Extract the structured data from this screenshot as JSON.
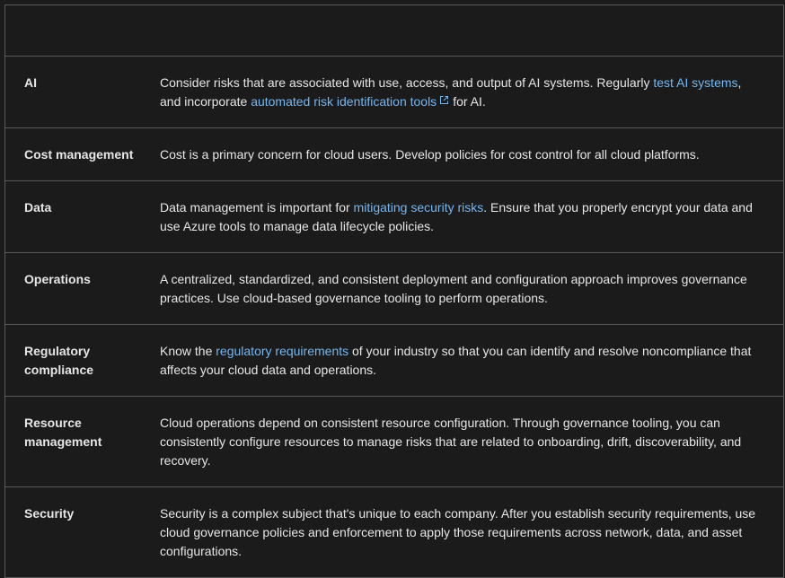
{
  "rows": [
    {
      "area": "AI",
      "desc": [
        {
          "t": "Consider risks that are associated with use, access, and output of AI systems. Regularly "
        },
        {
          "t": "test AI systems",
          "link": true
        },
        {
          "t": ", and incorporate "
        },
        {
          "t": "automated risk identification tools",
          "link": true,
          "external": true
        },
        {
          "t": "for AI."
        }
      ]
    },
    {
      "area": "Cost management",
      "desc": [
        {
          "t": "Cost is a primary concern for cloud users. Develop policies for cost control for all cloud platforms."
        }
      ]
    },
    {
      "area": "Data",
      "desc": [
        {
          "t": "Data management is important for "
        },
        {
          "t": "mitigating security risks",
          "link": true
        },
        {
          "t": ". Ensure that you properly encrypt your data and use Azure tools to manage data lifecycle policies."
        }
      ]
    },
    {
      "area": "Operations",
      "desc": [
        {
          "t": "A centralized, standardized, and consistent deployment and configuration approach improves governance practices. Use cloud-based governance tooling to perform operations."
        }
      ]
    },
    {
      "area": "Regulatory compliance",
      "desc": [
        {
          "t": "Know the "
        },
        {
          "t": "regulatory requirements",
          "link": true
        },
        {
          "t": " of your industry so that you can identify and resolve noncompliance that affects your cloud data and operations."
        }
      ]
    },
    {
      "area": "Resource management",
      "desc": [
        {
          "t": "Cloud operations depend on consistent resource configuration. Through governance tooling, you can consistently configure resources to manage risks that are related to onboarding, drift, discoverability, and recovery."
        }
      ]
    },
    {
      "area": "Security",
      "desc": [
        {
          "t": "Security is a complex subject that's unique to each company. After you establish security requirements, use cloud governance policies and enforcement to apply those requirements across network, data, and asset configurations."
        }
      ]
    }
  ]
}
